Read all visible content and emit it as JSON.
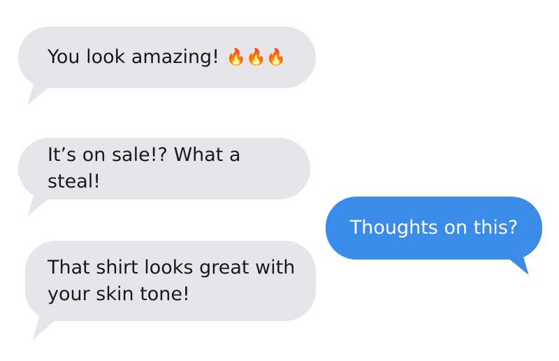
{
  "messages": [
    {
      "sender": "other",
      "text": "You look amazing!",
      "emoji": "🔥🔥🔥"
    },
    {
      "sender": "other",
      "text": "It’s on sale!? What a steal!"
    },
    {
      "sender": "other",
      "text": "That shirt looks great with your skin tone!"
    },
    {
      "sender": "me",
      "text": "Thoughts on this?"
    }
  ],
  "colors": {
    "incoming_bubble": "#e5e5ea",
    "outgoing_bubble": "#3b8be8",
    "incoming_text": "#1a1a1a",
    "outgoing_text": "#ffffff"
  },
  "icons": {
    "fire": "fire-emoji-icon"
  }
}
